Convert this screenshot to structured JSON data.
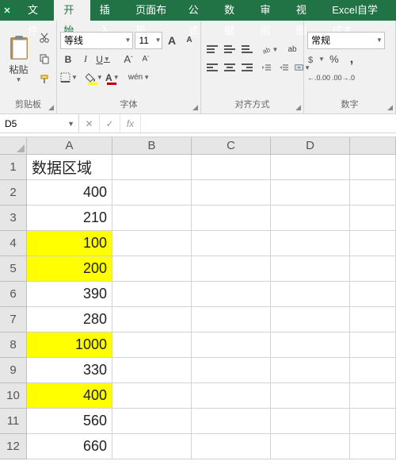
{
  "tabs": {
    "file": "文件",
    "home": "开始",
    "insert": "插入",
    "layout": "页面布局",
    "formulas": "公式",
    "data": "数据",
    "review": "审阅",
    "view": "视图",
    "addin": "Excel自学成才"
  },
  "clipboard": {
    "paste_label": "粘贴",
    "group_label": "剪贴板"
  },
  "font": {
    "name": "等线",
    "size": "11",
    "group_label": "字体",
    "bold": "B",
    "italic": "I",
    "underline": "U",
    "inc": "A",
    "dec": "A",
    "wen": "wén",
    "fillA": "A",
    "fontA": "A"
  },
  "align": {
    "group_label": "对齐方式",
    "wrap": "ab",
    "merge": "⇔"
  },
  "number": {
    "format": "常规",
    "group_label": "数字",
    "pct": "%",
    "comma": ",",
    "inc_dec": ".0",
    "dec_dec": ".00"
  },
  "namebox": "D5",
  "fx": "fx",
  "formula": "",
  "columns": [
    "A",
    "B",
    "C",
    "D",
    ""
  ],
  "rows": [
    {
      "n": "1",
      "a": "数据区域",
      "head": true,
      "hl": false
    },
    {
      "n": "2",
      "a": "400",
      "head": false,
      "hl": false
    },
    {
      "n": "3",
      "a": "210",
      "head": false,
      "hl": false
    },
    {
      "n": "4",
      "a": "100",
      "head": false,
      "hl": true
    },
    {
      "n": "5",
      "a": "200",
      "head": false,
      "hl": true
    },
    {
      "n": "6",
      "a": "390",
      "head": false,
      "hl": false
    },
    {
      "n": "7",
      "a": "280",
      "head": false,
      "hl": false
    },
    {
      "n": "8",
      "a": "1000",
      "head": false,
      "hl": true
    },
    {
      "n": "9",
      "a": "330",
      "head": false,
      "hl": false
    },
    {
      "n": "10",
      "a": "400",
      "head": false,
      "hl": true
    },
    {
      "n": "11",
      "a": "560",
      "head": false,
      "hl": false
    },
    {
      "n": "12",
      "a": "660",
      "head": false,
      "hl": false
    }
  ]
}
